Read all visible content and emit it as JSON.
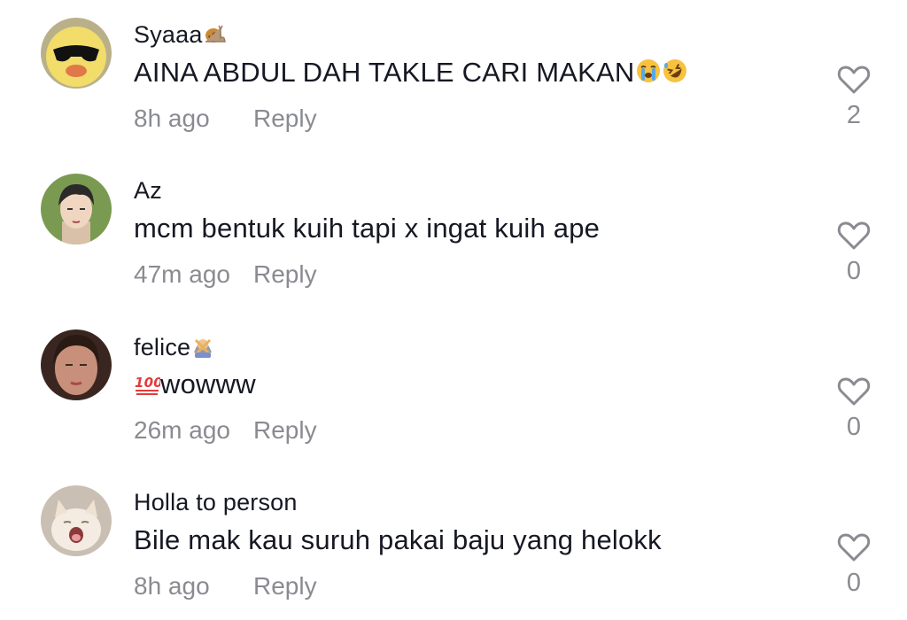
{
  "comments": [
    {
      "username": "Syaaa",
      "username_emoji": "snail",
      "text": "AINA ABDUL DAH TAKLE CARI MAKAN",
      "text_emojis": [
        "loudly-crying-face",
        "rolling-on-floor-laughing-face"
      ],
      "time": "8h ago",
      "reply_label": "Reply",
      "likes": "2",
      "avatar": "yellow-duck-with-sunglasses"
    },
    {
      "username": "Az",
      "text": "mcm bentuk kuih tapi x ingat kuih ape",
      "time": "47m ago",
      "reply_label": "Reply",
      "likes": "0",
      "avatar": "illustrated-man-dark-hair"
    },
    {
      "username": "felice",
      "username_emoji": "woman-gesturing-no",
      "text": "wowww",
      "text_prefix_emoji": "hundred-points",
      "time": "26m ago",
      "reply_label": "Reply",
      "likes": "0",
      "avatar": "woman-portrait"
    },
    {
      "username": "Holla to person",
      "text": "Bile mak kau suruh pakai baju yang helokk",
      "time": "8h ago",
      "reply_label": "Reply",
      "likes": "0",
      "avatar": "yawning-white-cat"
    }
  ],
  "colors": {
    "primary_text": "#161823",
    "secondary_text": "#8a8b91",
    "heart_outline": "#8a8b91"
  }
}
